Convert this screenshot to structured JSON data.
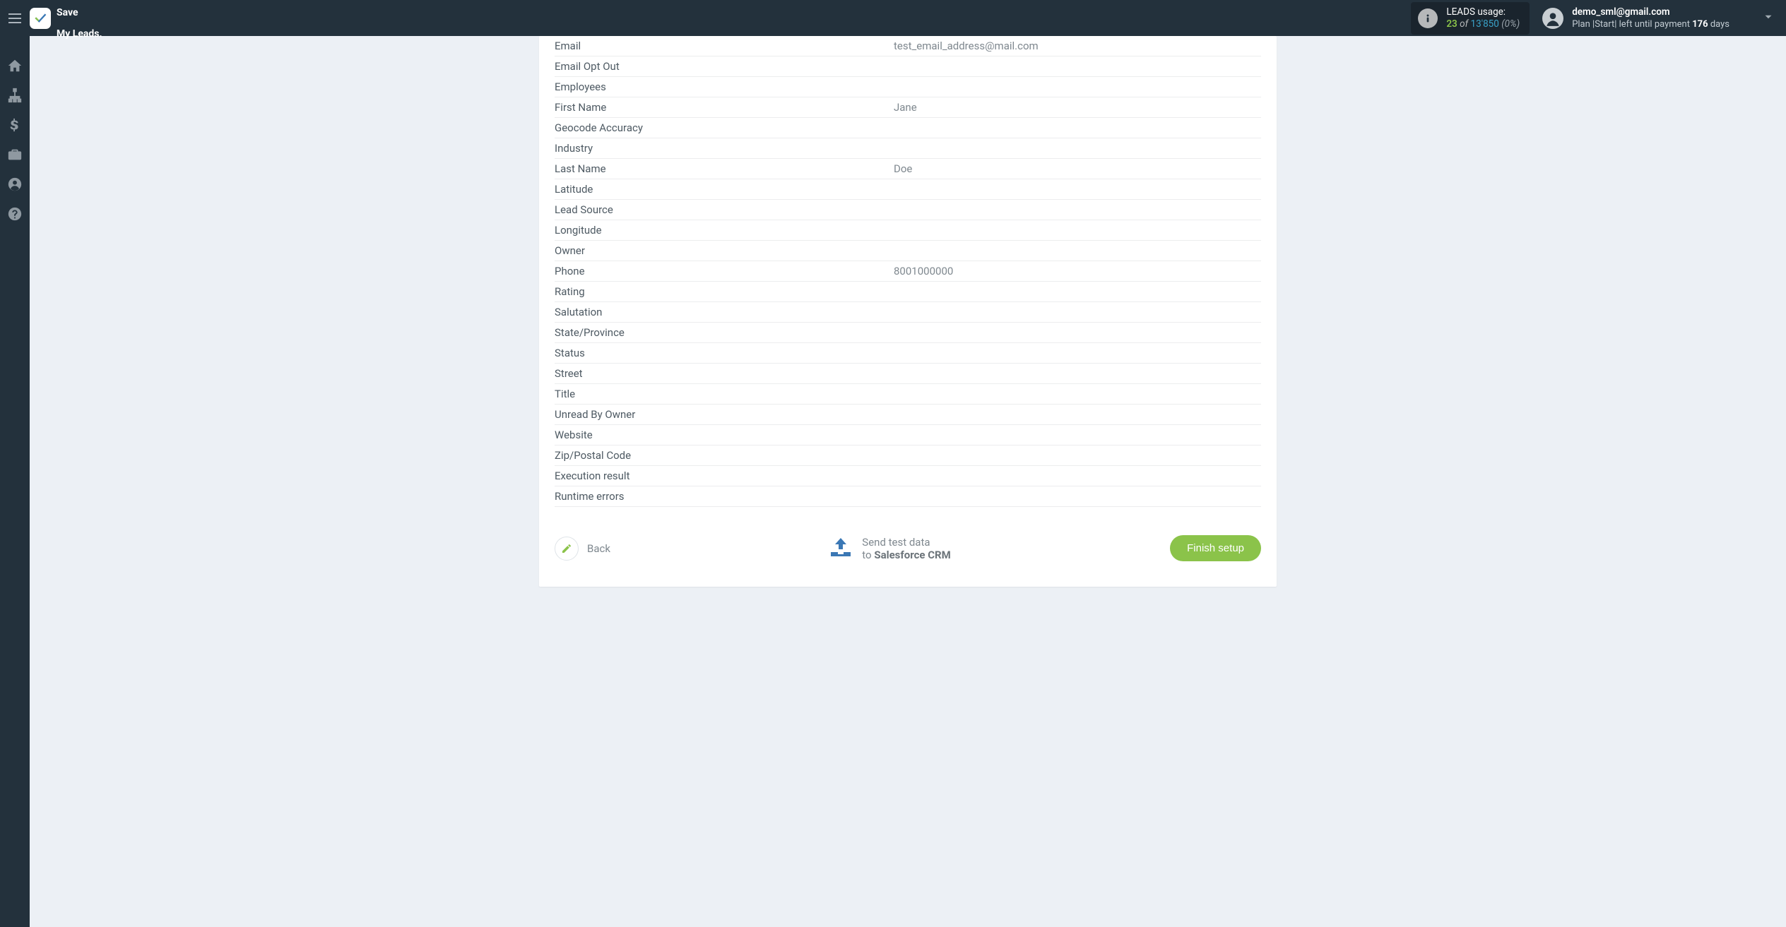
{
  "header": {
    "logo_line1": "Save",
    "logo_line2": "My Leads.",
    "leads": {
      "title": "LEADS usage:",
      "current": "23",
      "of_word": "of",
      "total": "13'850",
      "pct": "(0%)"
    },
    "user": {
      "email": "demo_sml@gmail.com",
      "plan_prefix": "Plan |Start| left until payment ",
      "days_num": "176",
      "days_word": " days"
    }
  },
  "fields": [
    {
      "label": "Email",
      "value": "test_email_address@mail.com"
    },
    {
      "label": "Email Opt Out",
      "value": ""
    },
    {
      "label": "Employees",
      "value": ""
    },
    {
      "label": "First Name",
      "value": "Jane"
    },
    {
      "label": "Geocode Accuracy",
      "value": ""
    },
    {
      "label": "Industry",
      "value": ""
    },
    {
      "label": "Last Name",
      "value": "Doe"
    },
    {
      "label": "Latitude",
      "value": ""
    },
    {
      "label": "Lead Source",
      "value": ""
    },
    {
      "label": "Longitude",
      "value": ""
    },
    {
      "label": "Owner",
      "value": ""
    },
    {
      "label": "Phone",
      "value": "8001000000"
    },
    {
      "label": "Rating",
      "value": ""
    },
    {
      "label": "Salutation",
      "value": ""
    },
    {
      "label": "State/Province",
      "value": ""
    },
    {
      "label": "Status",
      "value": ""
    },
    {
      "label": "Street",
      "value": ""
    },
    {
      "label": "Title",
      "value": ""
    },
    {
      "label": "Unread By Owner",
      "value": ""
    },
    {
      "label": "Website",
      "value": ""
    },
    {
      "label": "Zip/Postal Code",
      "value": ""
    },
    {
      "label": "Execution result",
      "value": ""
    },
    {
      "label": "Runtime errors",
      "value": ""
    }
  ],
  "actions": {
    "back": "Back",
    "send_line1": "Send test data",
    "send_line2_prefix": "to ",
    "send_line2_bold": "Salesforce CRM",
    "finish": "Finish setup"
  }
}
